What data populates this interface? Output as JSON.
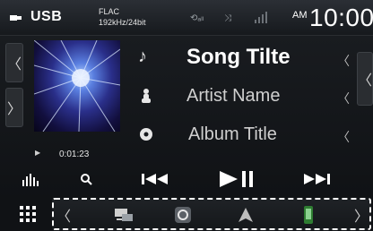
{
  "status": {
    "source_label": "USB",
    "format_line1": "FLAC",
    "format_line2": "192kHz/24bit",
    "clock_ampm": "AM",
    "clock_time": "10:00"
  },
  "track": {
    "song_title": "Song Tilte",
    "artist_name": "Artist Name",
    "album_title": "Album Title",
    "elapsed_time": "0:01:23"
  },
  "colors": {
    "accent": "#ffffff",
    "bar_bg": "#101215",
    "panel_bg": "#16191d"
  },
  "icons": {
    "source": "usb-icon",
    "song": "music-note-icon",
    "artist": "artist-icon",
    "album": "disc-icon",
    "equalizer": "equalizer-icon",
    "search": "search-icon",
    "previous": "previous-track-icon",
    "play_pause": "play-pause-icon",
    "next": "next-track-icon",
    "menu": "grid-menu-icon",
    "shortcuts": [
      "navigation-list-icon",
      "camera-icon",
      "navigation-arrow-icon",
      "phone-icon"
    ]
  }
}
